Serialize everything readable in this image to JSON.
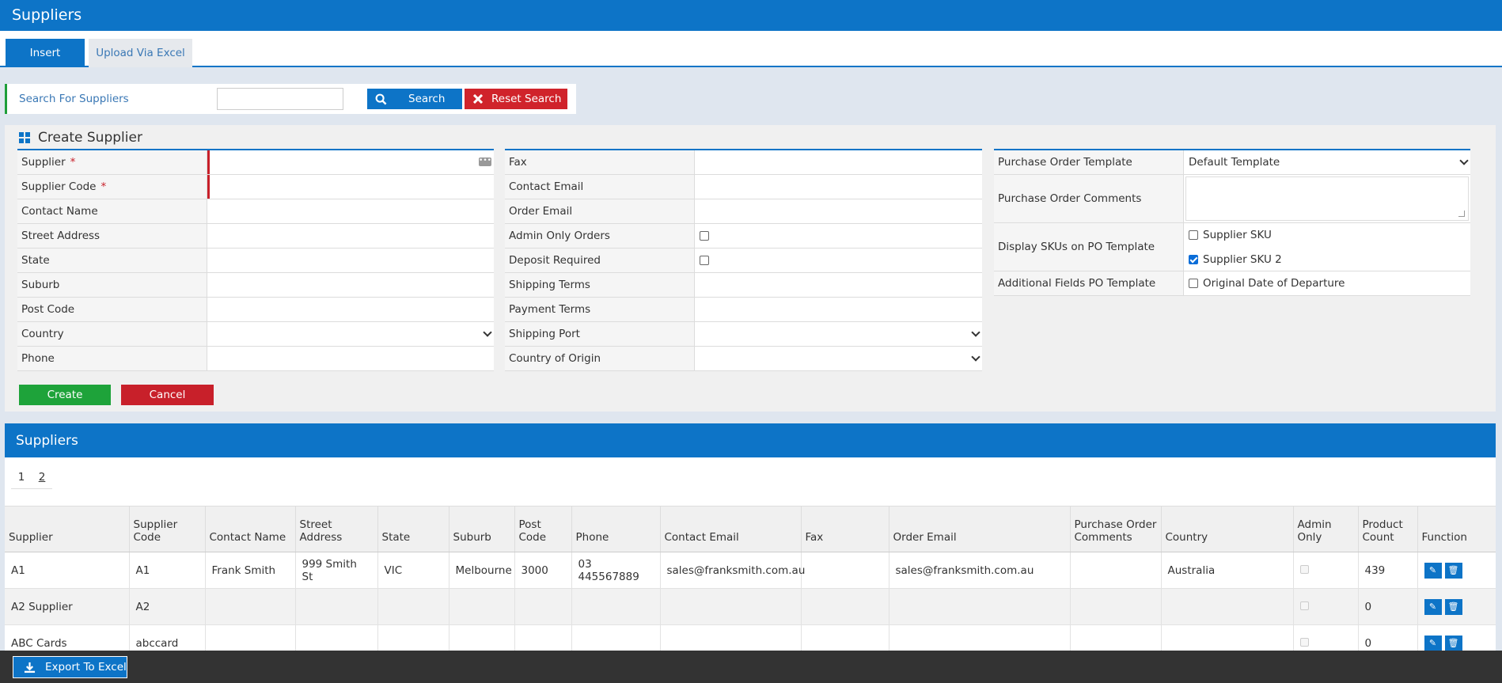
{
  "app": {
    "title": "Suppliers"
  },
  "tabs": [
    {
      "label": "Insert",
      "active": true
    },
    {
      "label": "Upload Via Excel",
      "active": false
    }
  ],
  "search": {
    "label": "Search For Suppliers",
    "value": "",
    "search_button": "Search",
    "reset_button": "Reset Search"
  },
  "create": {
    "title": "Create Supplier",
    "col1": [
      {
        "label": "Supplier",
        "required": true,
        "type": "text-picker"
      },
      {
        "label": "Supplier Code",
        "required": true,
        "type": "text"
      },
      {
        "label": "Contact Name",
        "type": "text"
      },
      {
        "label": "Street Address",
        "type": "text"
      },
      {
        "label": "State",
        "type": "text"
      },
      {
        "label": "Suburb",
        "type": "text"
      },
      {
        "label": "Post Code",
        "type": "text"
      },
      {
        "label": "Country",
        "type": "select"
      },
      {
        "label": "Phone",
        "type": "text"
      }
    ],
    "col2": [
      {
        "label": "Fax",
        "type": "text"
      },
      {
        "label": "Contact Email",
        "type": "text"
      },
      {
        "label": "Order Email",
        "type": "text"
      },
      {
        "label": "Admin Only Orders",
        "type": "checkbox",
        "checked": false
      },
      {
        "label": "Deposit Required",
        "type": "checkbox",
        "checked": false
      },
      {
        "label": "Shipping Terms",
        "type": "text"
      },
      {
        "label": "Payment Terms",
        "type": "text"
      },
      {
        "label": "Shipping Port",
        "type": "select"
      },
      {
        "label": "Country of Origin",
        "type": "select"
      }
    ],
    "col3": {
      "po_template_label": "Purchase Order Template",
      "po_template_value": "Default Template",
      "po_comments_label": "Purchase Order Comments",
      "display_skus_label": "Display SKUs on PO Template",
      "sku_options": [
        {
          "label": "Supplier SKU",
          "checked": false
        },
        {
          "label": "Supplier SKU 2",
          "checked": true
        }
      ],
      "additional_fields_label": "Additional Fields PO Template",
      "additional_option": {
        "label": "Original Date of Departure",
        "checked": false
      }
    },
    "create_button": "Create",
    "cancel_button": "Cancel"
  },
  "suppliers": {
    "title": "Suppliers",
    "pages": [
      "1",
      "2"
    ],
    "columns": [
      "Supplier",
      "Supplier Code",
      "Contact Name",
      "Street Address",
      "State",
      "Suburb",
      "Post Code",
      "Phone",
      "Contact Email",
      "Fax",
      "Order Email",
      "Purchase Order Comments",
      "Country",
      "Admin Only",
      "Product Count",
      "Function"
    ],
    "rows": [
      {
        "supplier": "A1",
        "code": "A1",
        "contact": "Frank Smith",
        "street": "999 Smith St",
        "state": "VIC",
        "suburb": "Melbourne",
        "postcode": "3000",
        "phone": "03 445567889",
        "contact_email": "sales@franksmith.com.au",
        "fax": "",
        "order_email": "sales@franksmith.com.au",
        "po_comments": "",
        "country": "Australia",
        "product_count": "439"
      },
      {
        "supplier": "A2 Supplier",
        "code": "A2",
        "contact": "",
        "street": "",
        "state": "",
        "suburb": "",
        "postcode": "",
        "phone": "",
        "contact_email": "",
        "fax": "",
        "order_email": "",
        "po_comments": "",
        "country": "",
        "product_count": "0"
      },
      {
        "supplier": "ABC Cards",
        "code": "abccard",
        "contact": "",
        "street": "",
        "state": "",
        "suburb": "",
        "postcode": "",
        "phone": "",
        "contact_email": "",
        "fax": "",
        "order_email": "",
        "po_comments": "",
        "country": "",
        "product_count": "0"
      }
    ]
  },
  "footer": {
    "export_button": "Export To Excel"
  },
  "icons": {
    "search": "search-icon",
    "reset": "close-icon",
    "create_title": "grid-icon",
    "edit": "pencil-icon",
    "delete": "trash-icon",
    "export": "download-icon"
  },
  "colors": {
    "primary": "#0d74c7",
    "success": "#1ea33a",
    "danger": "#c8202a",
    "footer": "#333333"
  }
}
